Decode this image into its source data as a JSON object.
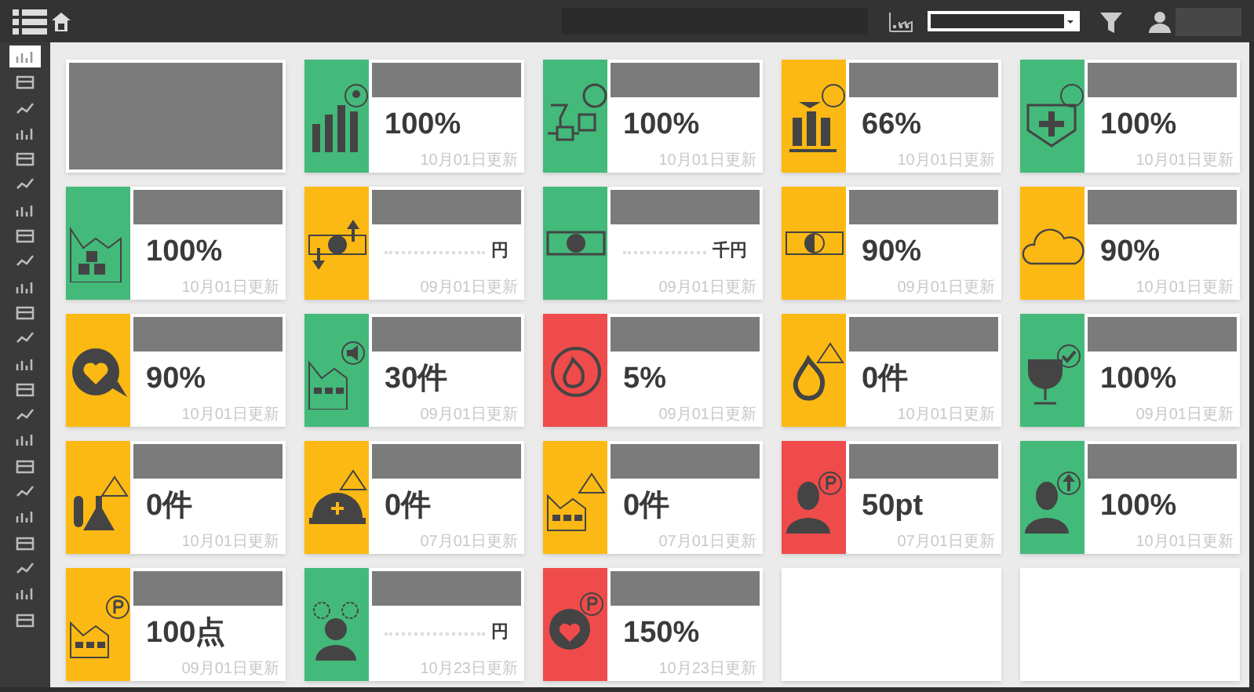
{
  "sidebar": {
    "items": [
      {
        "selected": true
      },
      {
        "selected": false
      },
      {
        "selected": false
      },
      {
        "selected": false
      },
      {
        "selected": false
      },
      {
        "selected": false
      },
      {
        "selected": false
      },
      {
        "selected": false
      },
      {
        "selected": false
      },
      {
        "selected": false
      },
      {
        "selected": false
      },
      {
        "selected": false
      },
      {
        "selected": false
      },
      {
        "selected": false
      },
      {
        "selected": false
      },
      {
        "selected": false
      },
      {
        "selected": false
      },
      {
        "selected": false
      },
      {
        "selected": false
      },
      {
        "selected": false
      },
      {
        "selected": false
      },
      {
        "selected": false
      },
      {
        "selected": false
      }
    ]
  },
  "cards": [
    {
      "kind": "picture"
    },
    {
      "kind": "metric",
      "color": "#43b97a",
      "value": "100%",
      "masked": false,
      "date": "10月01日更新"
    },
    {
      "kind": "metric",
      "color": "#43b97a",
      "value": "100%",
      "masked": false,
      "date": "10月01日更新"
    },
    {
      "kind": "metric",
      "color": "#fdb913",
      "value": "66%",
      "masked": false,
      "date": "10月01日更新"
    },
    {
      "kind": "metric",
      "color": "#43b97a",
      "value": "100%",
      "masked": false,
      "date": "10月01日更新"
    },
    {
      "kind": "metric",
      "color": "#43b97a",
      "value": "100%",
      "masked": false,
      "date": "10月01日更新"
    },
    {
      "kind": "metric",
      "color": "#fdb913",
      "value": "円",
      "masked": true,
      "date": "09月01日更新"
    },
    {
      "kind": "metric",
      "color": "#43b97a",
      "value": "千円",
      "masked": true,
      "date": "09月01日更新"
    },
    {
      "kind": "metric",
      "color": "#fdb913",
      "value": "90%",
      "masked": false,
      "date": "09月01日更新"
    },
    {
      "kind": "metric",
      "color": "#fdb913",
      "value": "90%",
      "masked": false,
      "date": "10月01日更新"
    },
    {
      "kind": "metric",
      "color": "#fdb913",
      "value": "90%",
      "masked": false,
      "date": "10月01日更新"
    },
    {
      "kind": "metric",
      "color": "#43b97a",
      "value": "30件",
      "masked": false,
      "date": "09月01日更新"
    },
    {
      "kind": "metric",
      "color": "#ef4b4b",
      "value": "5%",
      "masked": false,
      "date": "09月01日更新"
    },
    {
      "kind": "metric",
      "color": "#fdb913",
      "value": "0件",
      "masked": false,
      "date": "10月01日更新"
    },
    {
      "kind": "metric",
      "color": "#43b97a",
      "value": "100%",
      "masked": false,
      "date": "09月01日更新"
    },
    {
      "kind": "metric",
      "color": "#fdb913",
      "value": "0件",
      "masked": false,
      "date": "10月01日更新"
    },
    {
      "kind": "metric",
      "color": "#fdb913",
      "value": "0件",
      "masked": false,
      "date": "07月01日更新"
    },
    {
      "kind": "metric",
      "color": "#fdb913",
      "value": "0件",
      "masked": false,
      "date": "07月01日更新"
    },
    {
      "kind": "metric",
      "color": "#ef4b4b",
      "value": "50pt",
      "masked": false,
      "date": "07月01日更新"
    },
    {
      "kind": "metric",
      "color": "#43b97a",
      "value": "100%",
      "masked": false,
      "date": "10月01日更新"
    },
    {
      "kind": "metric",
      "color": "#fdb913",
      "value": "100点",
      "masked": false,
      "date": "09月01日更新"
    },
    {
      "kind": "metric",
      "color": "#43b97a",
      "value": "円",
      "masked": true,
      "date": "10月23日更新"
    },
    {
      "kind": "metric",
      "color": "#ef4b4b",
      "value": "150%",
      "masked": false,
      "date": "10月23日更新"
    },
    {
      "kind": "empty"
    },
    {
      "kind": "empty"
    }
  ]
}
